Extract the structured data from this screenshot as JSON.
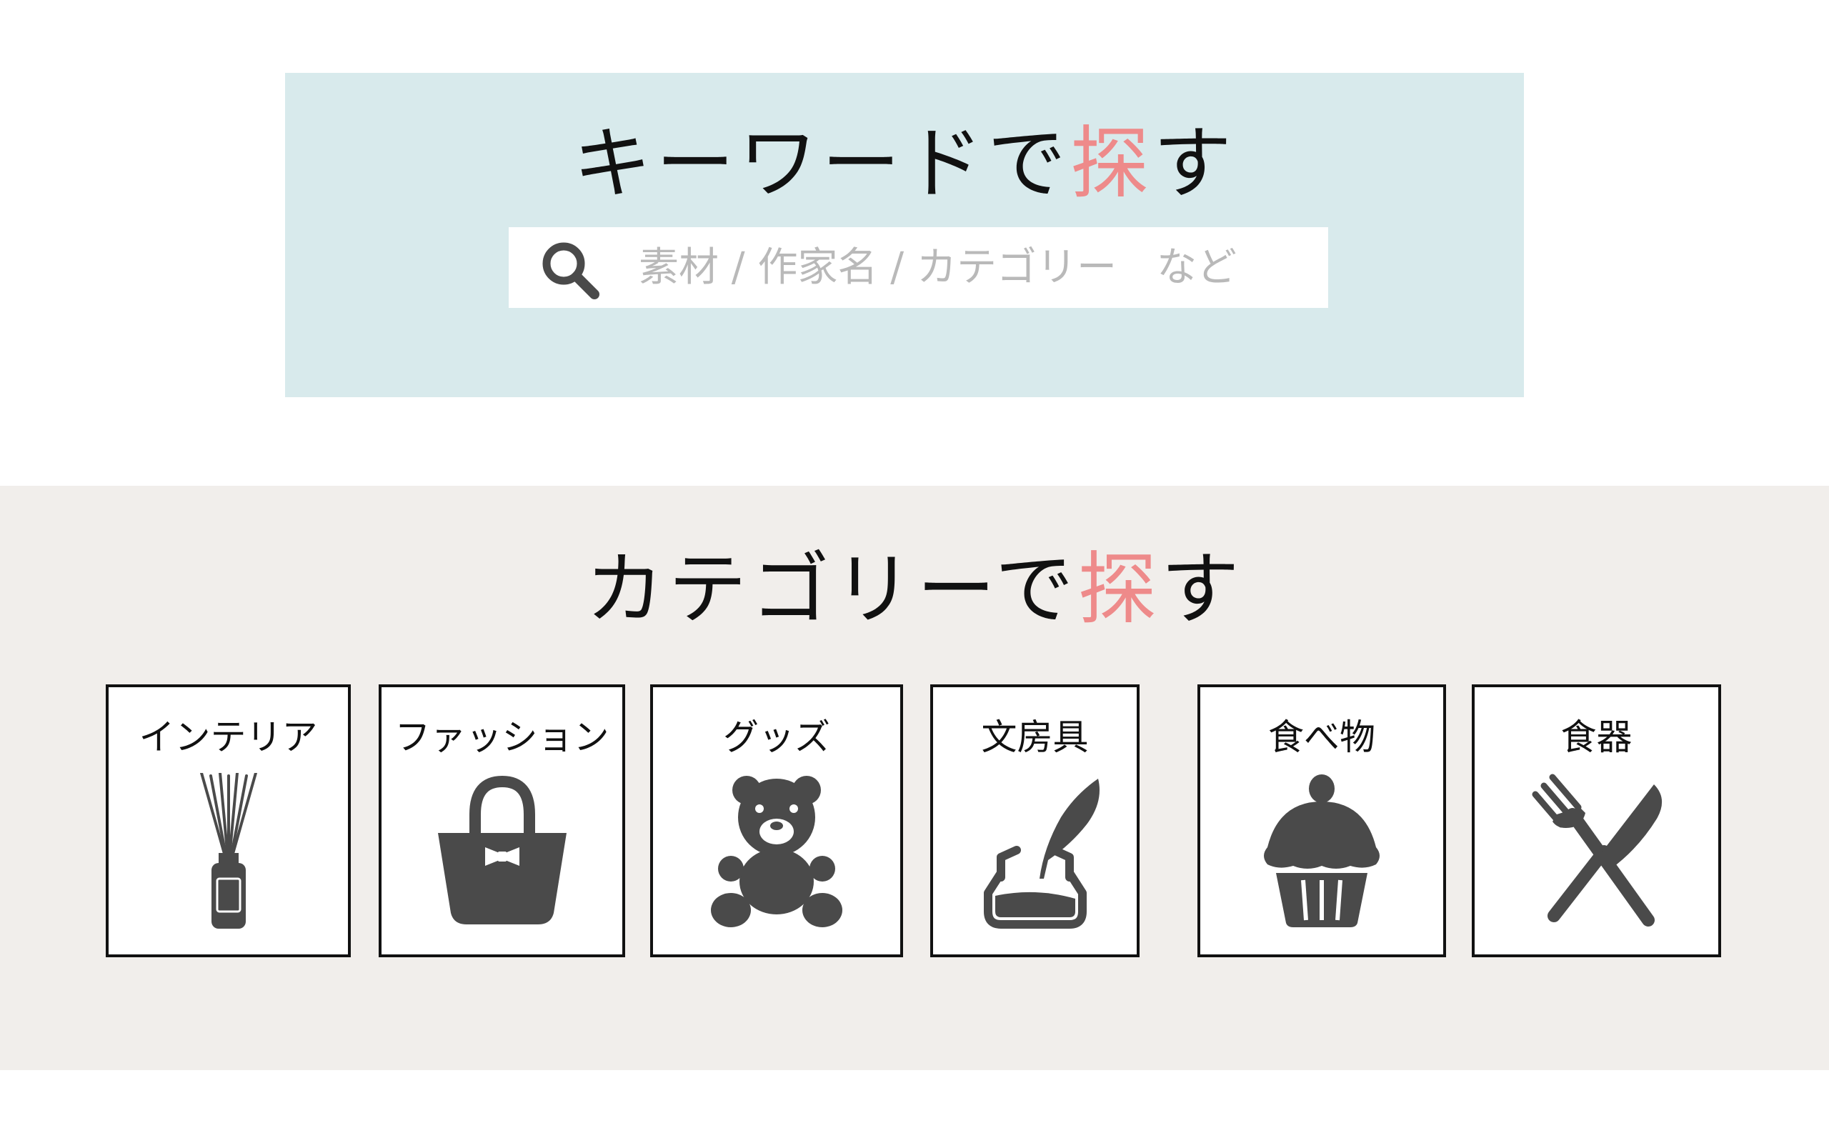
{
  "keyword_search": {
    "title_prefix": "キーワードで",
    "title_accent": "探",
    "title_suffix": "す",
    "placeholder": "素材 / 作家名 / カテゴリー　など",
    "search_icon": "search-icon"
  },
  "category_search": {
    "title_prefix": "カテゴリーで",
    "title_accent": "探",
    "title_suffix": "す",
    "categories": [
      {
        "label": "インテリア",
        "icon": "diffuser-icon"
      },
      {
        "label": "ファッション",
        "icon": "tote-bag-icon"
      },
      {
        "label": "グッズ",
        "icon": "teddy-bear-icon"
      },
      {
        "label": "文房具",
        "icon": "quill-ink-icon"
      },
      {
        "label": "食べ物",
        "icon": "cupcake-icon"
      },
      {
        "label": "食器",
        "icon": "fork-knife-icon"
      }
    ]
  },
  "colors": {
    "keyword_panel_bg": "#d8eaec",
    "category_section_bg": "#f1eeeb",
    "accent": "#ee8a8a",
    "icon": "#4a4a4a",
    "placeholder": "#b9b9b9"
  }
}
